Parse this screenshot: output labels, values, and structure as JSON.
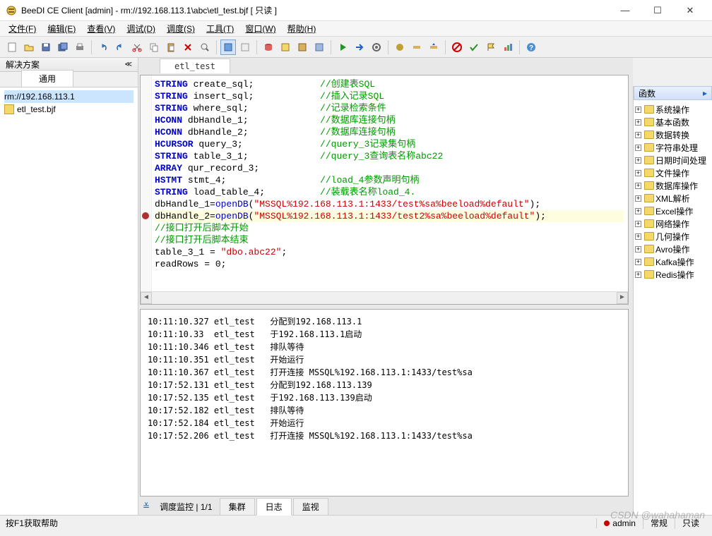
{
  "window": {
    "title": "BeeDI CE Client [admin] - rm://192.168.113.1\\abc\\etl_test.bjf [ 只读 ]"
  },
  "menu": {
    "items": [
      "文件(F)",
      "编辑(E)",
      "查看(V)",
      "调试(D)",
      "调度(S)",
      "工具(T)",
      "窗口(W)",
      "帮助(H)"
    ]
  },
  "leftpane": {
    "title": "解决方案",
    "tab": "通用",
    "root": "rm://192.168.113.1",
    "file": "etl_test.bjf"
  },
  "editor": {
    "tab": "etl_test",
    "lines": [
      {
        "t": "decl",
        "kw": "STRING",
        "name": "create_sql;",
        "comment": "//创建表SQL"
      },
      {
        "t": "decl",
        "kw": "STRING",
        "name": "insert_sql;",
        "comment": "//插入记录SQL"
      },
      {
        "t": "decl",
        "kw": "STRING",
        "name": "where_sql;",
        "comment": "//记录检索条件"
      },
      {
        "t": "decl",
        "kw": "HCONN",
        "name": "dbHandle_1;",
        "comment": "//数据库连接句柄"
      },
      {
        "t": "decl",
        "kw": "HCONN",
        "name": "dbHandle_2;",
        "comment": "//数据库连接句柄"
      },
      {
        "t": "decl",
        "kw": "HCURSOR",
        "name": "query_3;",
        "comment": "//query_3记录集句柄"
      },
      {
        "t": "decl",
        "kw": "STRING",
        "name": "table_3_1;",
        "comment": "//query_3查询表名称abc22"
      },
      {
        "t": "decl",
        "kw": "ARRAY",
        "name": "qur_record_3;",
        "comment": ""
      },
      {
        "t": "decl",
        "kw": "HSTMT",
        "name": "stmt_4;",
        "comment": "//load_4参数声明句柄"
      },
      {
        "t": "decl",
        "kw": "STRING",
        "name": "load_table_4;",
        "comment": "//装载表名称load_4."
      },
      {
        "t": "open",
        "var": "dbHandle_1=",
        "fn": "openDB",
        "arg": "\"MSSQL%192.168.113.1:1433/test%sa%beeload%default\"",
        "tail": ");"
      },
      {
        "t": "open",
        "var": "dbHandle_2=",
        "fn": "openDB",
        "arg": "\"MSSQL%192.168.113.1:1433/test2%sa%beeload%default\"",
        "tail": ");",
        "bp": true,
        "hl": true
      },
      {
        "t": "cm",
        "text": "//接口打开后脚本开始"
      },
      {
        "t": "cm",
        "text": "//接口打开后脚本结束"
      },
      {
        "t": "assign",
        "var": "table_3_1 = ",
        "str": "\"dbo.abc22\"",
        "tail": ";"
      },
      {
        "t": "plain",
        "text": "readRows = 0;"
      }
    ]
  },
  "log": {
    "rows": [
      {
        "time": "10:11:10.327",
        "src": "etl_test",
        "msg": "分配到192.168.113.1"
      },
      {
        "time": "10:11:10.33",
        "src": "etl_test",
        "msg": "于192.168.113.1启动"
      },
      {
        "time": "10:11:10.346",
        "src": "etl_test",
        "msg": "排队等待"
      },
      {
        "time": "10:11:10.351",
        "src": "etl_test",
        "msg": "开始运行"
      },
      {
        "time": "10:11:10.367",
        "src": "etl_test",
        "msg": "打开连接 MSSQL%192.168.113.1:1433/test%sa"
      },
      {
        "time": "10:17:52.131",
        "src": "etl_test",
        "msg": "分配到192.168.113.139"
      },
      {
        "time": "10:17:52.135",
        "src": "etl_test",
        "msg": "于192.168.113.139启动"
      },
      {
        "time": "10:17:52.182",
        "src": "etl_test",
        "msg": "排队等待"
      },
      {
        "time": "10:17:52.184",
        "src": "etl_test",
        "msg": "开始运行"
      },
      {
        "time": "10:17:52.206",
        "src": "etl_test",
        "msg": "打开连接 MSSQL%192.168.113.1:1433/test%sa"
      }
    ]
  },
  "bottom": {
    "label_prefix": "调度监控",
    "pager": "1/1",
    "tabs": [
      "集群",
      "日志",
      "监视"
    ],
    "active": 1,
    "collapse": "≚"
  },
  "rightpane": {
    "title": "函数",
    "groups": [
      "系统操作",
      "基本函数",
      "数据转换",
      "字符串处理",
      "日期时间处理",
      "文件操作",
      "数据库操作",
      "XML解析",
      "Excel操作",
      "网络操作",
      "几何操作",
      "Avro操作",
      "Kafka操作",
      "Redis操作"
    ]
  },
  "status": {
    "help": "按F1获取帮助",
    "user": "admin",
    "mode": "常规",
    "readonly": "只读"
  },
  "watermark": "CSDN @wahahaman"
}
